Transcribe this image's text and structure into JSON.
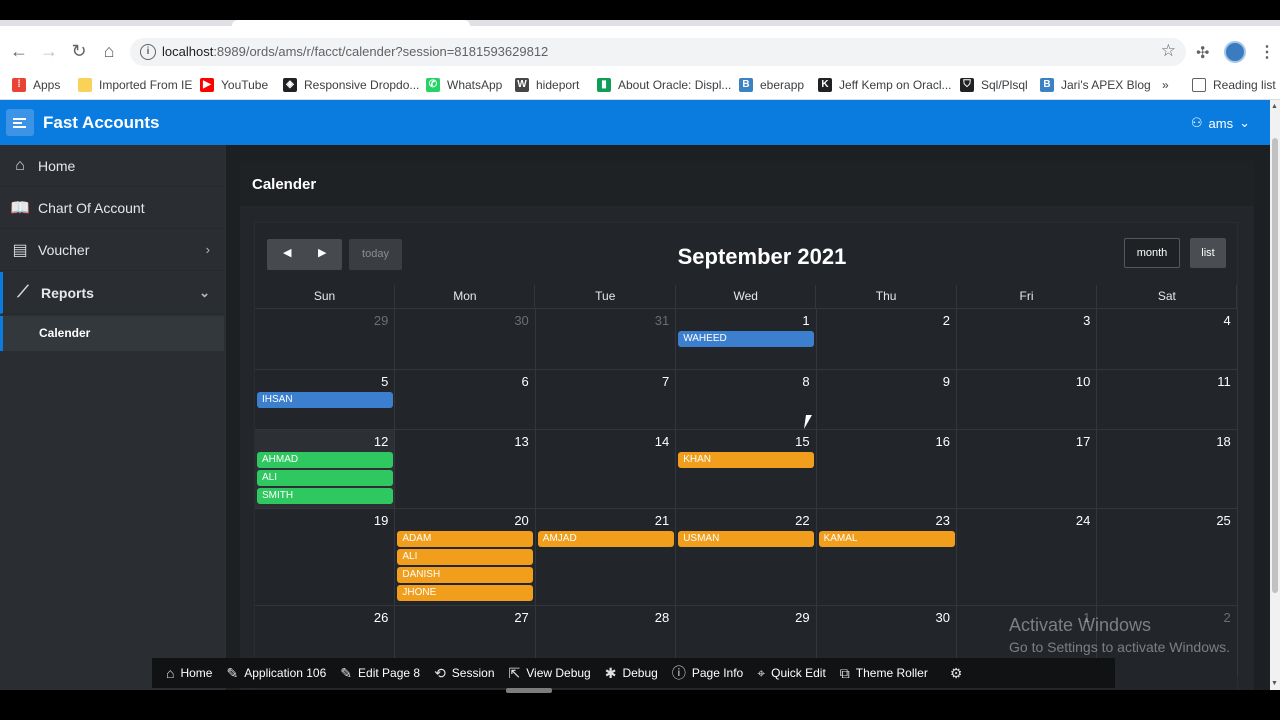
{
  "browser": {
    "url_host": "localhost",
    "url_rest": ":8989/ords/ams/r/facct/calender?session=8181593629812",
    "bookmarks": [
      {
        "label": "Apps",
        "icon": "apps-grid-icon",
        "color": "#ea4335"
      },
      {
        "label": "Imported From IE",
        "icon": "folder-icon",
        "color": "#f9d25a"
      },
      {
        "label": "YouTube",
        "icon": "youtube-icon",
        "color": "#ff0000"
      },
      {
        "label": "Responsive Dropdo...",
        "icon": "codepen-icon",
        "color": "#202124"
      },
      {
        "label": "WhatsApp",
        "icon": "whatsapp-icon",
        "color": "#25d366"
      },
      {
        "label": "hideport",
        "icon": "wordpress-icon",
        "color": "#464646"
      },
      {
        "label": "About Oracle: Displ...",
        "icon": "bookmark-icon",
        "color": "#0f9d58"
      },
      {
        "label": "eberapp",
        "icon": "b-icon",
        "color": "#3b82c4"
      },
      {
        "label": "Jeff Kemp on Oracl...",
        "icon": "k64-icon",
        "color": "#202124"
      },
      {
        "label": "Sql/Plsql",
        "icon": "shield-icon",
        "color": "#202124"
      },
      {
        "label": "Jari's APEX Blog",
        "icon": "blog-icon",
        "color": "#3b82c4"
      }
    ],
    "more_label": "»",
    "reading_list": "Reading list"
  },
  "app": {
    "title": "Fast Accounts",
    "user": "ams",
    "header_color": "#0a7ce0"
  },
  "sidebar": {
    "items": [
      {
        "label": "Home",
        "icon": "home-icon"
      },
      {
        "label": "Chart Of Account",
        "icon": "book-icon"
      },
      {
        "label": "Voucher",
        "icon": "document-icon"
      },
      {
        "label": "Reports",
        "icon": "chart-icon"
      }
    ],
    "sub_item": "Calender"
  },
  "region": {
    "title": "Calender"
  },
  "calendar": {
    "title": "September 2021",
    "today_label": "today",
    "month_label": "month",
    "list_label": "list",
    "days_of_week": [
      "Sun",
      "Mon",
      "Tue",
      "Wed",
      "Thu",
      "Fri",
      "Sat"
    ],
    "weeks": [
      {
        "days": [
          "29",
          "30",
          "31",
          "1",
          "2",
          "3",
          "4"
        ],
        "other": [
          true,
          true,
          true,
          false,
          false,
          false,
          false
        ]
      },
      {
        "days": [
          "5",
          "6",
          "7",
          "8",
          "9",
          "10",
          "11"
        ],
        "other": [
          false,
          false,
          false,
          false,
          false,
          false,
          false
        ]
      },
      {
        "days": [
          "12",
          "13",
          "14",
          "15",
          "16",
          "17",
          "18"
        ],
        "other": [
          false,
          false,
          false,
          false,
          false,
          false,
          false
        ]
      },
      {
        "days": [
          "19",
          "20",
          "21",
          "22",
          "23",
          "24",
          "25"
        ],
        "other": [
          false,
          false,
          false,
          false,
          false,
          false,
          false
        ]
      },
      {
        "days": [
          "26",
          "27",
          "28",
          "29",
          "30",
          "1",
          "2"
        ],
        "other": [
          false,
          false,
          false,
          false,
          false,
          true,
          true
        ]
      }
    ],
    "events": [
      {
        "week": 0,
        "day": 3,
        "slot": 0,
        "title": "WAHEED",
        "color": "blue"
      },
      {
        "week": 1,
        "day": 0,
        "slot": 0,
        "title": "IHSAN",
        "color": "blue"
      },
      {
        "week": 2,
        "day": 0,
        "slot": 0,
        "title": "AHMAD",
        "color": "green"
      },
      {
        "week": 2,
        "day": 0,
        "slot": 1,
        "title": "ALI",
        "color": "green"
      },
      {
        "week": 2,
        "day": 0,
        "slot": 2,
        "title": "SMITH",
        "color": "green"
      },
      {
        "week": 2,
        "day": 3,
        "slot": 0,
        "title": "KHAN",
        "color": "orange"
      },
      {
        "week": 3,
        "day": 1,
        "slot": 0,
        "title": "ADAM",
        "color": "orange"
      },
      {
        "week": 3,
        "day": 1,
        "slot": 1,
        "title": "ALI",
        "color": "orange"
      },
      {
        "week": 3,
        "day": 1,
        "slot": 2,
        "title": "DANISH",
        "color": "orange"
      },
      {
        "week": 3,
        "day": 1,
        "slot": 3,
        "title": "JHONE",
        "color": "orange"
      },
      {
        "week": 3,
        "day": 2,
        "slot": 0,
        "title": "AMJAD",
        "color": "orange"
      },
      {
        "week": 3,
        "day": 3,
        "slot": 0,
        "title": "USMAN",
        "color": "orange"
      },
      {
        "week": 3,
        "day": 4,
        "slot": 0,
        "title": "KAMAL",
        "color": "orange"
      }
    ]
  },
  "devbar": [
    {
      "label": "Home",
      "icon": "home-icon"
    },
    {
      "label": "Application 106",
      "icon": "edit-icon"
    },
    {
      "label": "Edit Page 8",
      "icon": "edit-icon"
    },
    {
      "label": "Session",
      "icon": "session-icon"
    },
    {
      "label": "View Debug",
      "icon": "external-icon"
    },
    {
      "label": "Debug",
      "icon": "bug-icon"
    },
    {
      "label": "Page Info",
      "icon": "info-icon"
    },
    {
      "label": "Quick Edit",
      "icon": "quick-edit-icon"
    },
    {
      "label": "Theme Roller",
      "icon": "paint-roller-icon"
    },
    {
      "label": "",
      "icon": "gear-icon"
    }
  ],
  "watermark": {
    "line1": "Activate Windows",
    "line2": "Go to Settings to activate Windows."
  }
}
